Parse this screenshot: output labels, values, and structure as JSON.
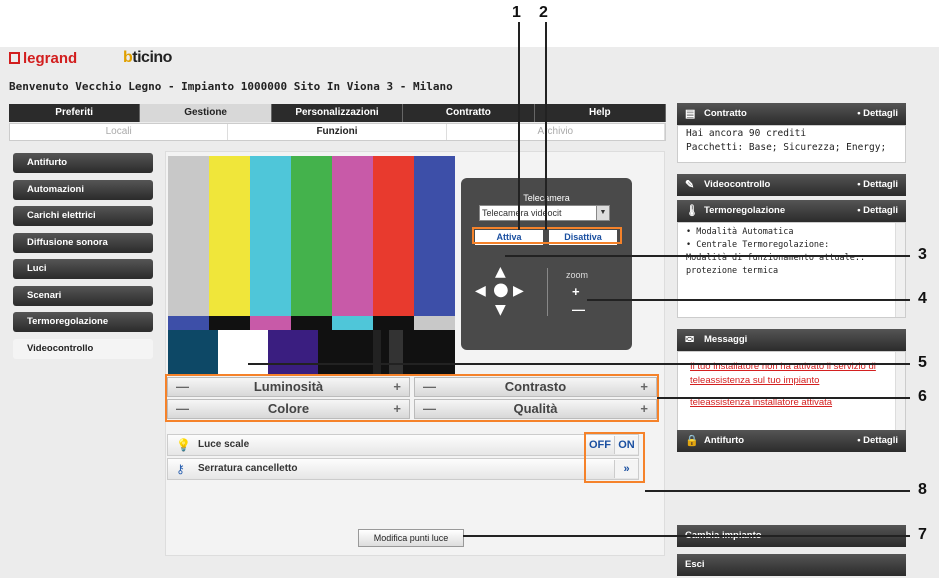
{
  "header": {
    "logo_legrand": "legrand",
    "logo_bticino": "bticino",
    "welcome": "Benvenuto Vecchio Legno - Impianto 1000000 Sito In Viona 3 - Milano"
  },
  "tabs": [
    "Preferiti",
    "Gestione",
    "Personalizzazioni",
    "Contratto",
    "Help"
  ],
  "active_tab": "Gestione",
  "subtabs": [
    "Locali",
    "Funzioni",
    "Archivio"
  ],
  "active_subtab": "Funzioni",
  "menu": [
    "Antifurto",
    "Automazioni",
    "Carichi elettrici",
    "Diffusione sonora",
    "Luci",
    "Scenari",
    "Termoregolazione",
    "Videocontrollo"
  ],
  "menu_selected": "Videocontrollo",
  "camera": {
    "title": "Telecamera",
    "select_value": "Telecamera videocit",
    "activate": "Attiva",
    "deactivate": "Disattiva",
    "zoom_label": "zoom",
    "zoom_plus": "+",
    "zoom_minus": "—"
  },
  "adjust": [
    {
      "label": "Luminosità",
      "minus": "—",
      "plus": "+"
    },
    {
      "label": "Contrasto",
      "minus": "—",
      "plus": "+"
    },
    {
      "label": "Colore",
      "minus": "—",
      "plus": "+"
    },
    {
      "label": "Qualità",
      "minus": "—",
      "plus": "+"
    }
  ],
  "lights": [
    {
      "label": "Luce scale",
      "off": "OFF",
      "on": "ON"
    },
    {
      "label": "Serratura cancelletto",
      "go": "»"
    }
  ],
  "modify_button": "Modifica punti luce",
  "right": {
    "contratto": {
      "title": "Contratto",
      "details": "• Dettagli",
      "line1": "Hai ancora 90 crediti",
      "line2": "Pacchetti: Base; Sicurezza; Energy;"
    },
    "video": {
      "title": "Videocontrollo",
      "details": "• Dettagli"
    },
    "termo": {
      "title": "Termoregolazione",
      "details": "• Dettagli",
      "line1": "• Modalità        Automatica",
      "line2": "• Centrale Termoregolazione:",
      "line3": "Modalità di funzionamento attuale::",
      "line4": "protezione termica"
    },
    "messaggi": {
      "title": "Messaggi",
      "msg1": "Il tuo installatore non ha attivato il servizio di teleassistenza sul tuo impianto",
      "msg2": "teleassistenza installatore attivata"
    },
    "antifurto": {
      "title": "Antifurto",
      "details": "• Dettagli"
    },
    "cambia": "Cambia impianto",
    "esci": "Esci"
  },
  "callouts": [
    "1",
    "2",
    "3",
    "4",
    "5",
    "6",
    "7",
    "8"
  ],
  "colors": {
    "accent_orange": "#f5822a",
    "link_blue": "#1a4fa0",
    "alert_red": "#d42020"
  }
}
